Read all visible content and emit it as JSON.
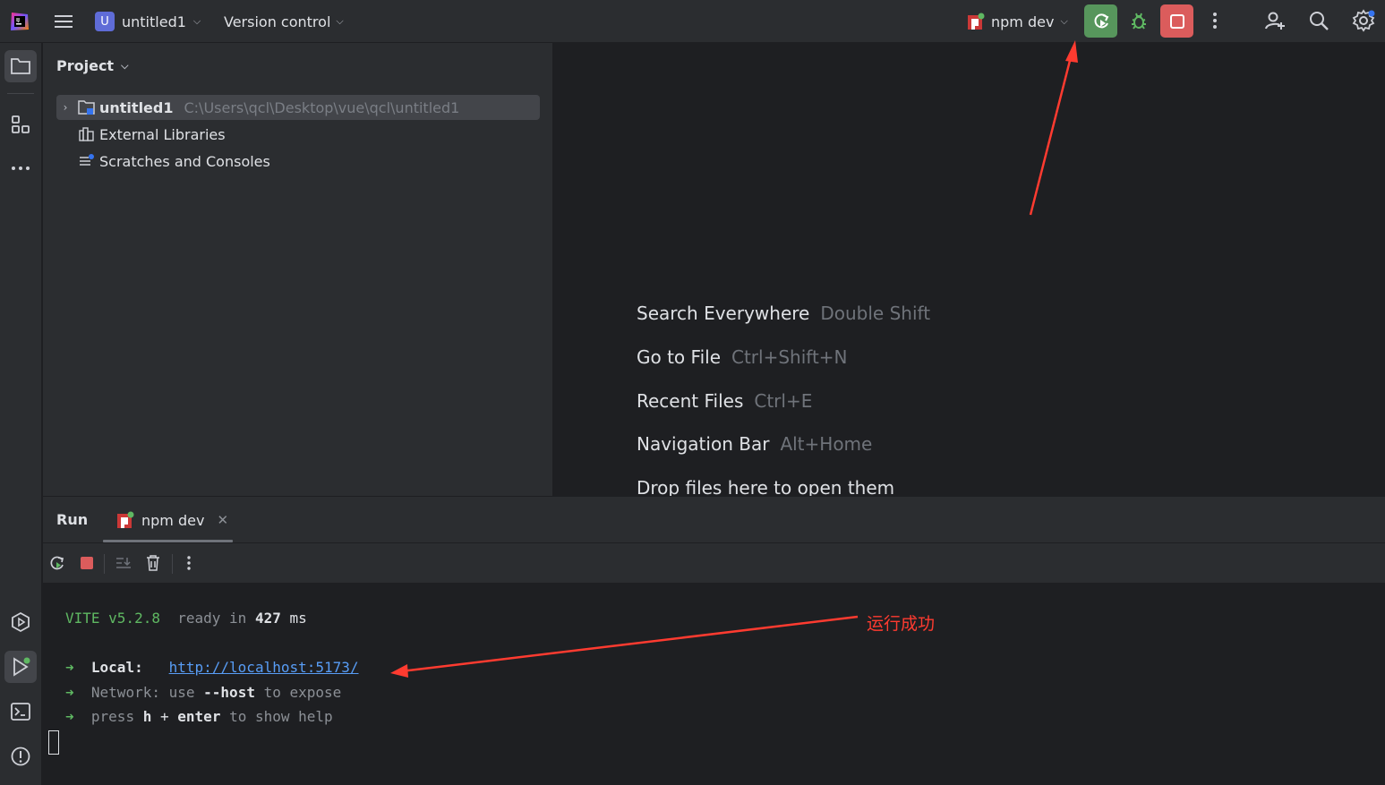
{
  "titlebar": {
    "project_badge": "U",
    "project_name": "untitled1",
    "vcs_label": "Version control",
    "run_config": "npm dev",
    "icons": [
      "app-logo-icon",
      "main-menu-icon",
      "rerun-icon",
      "debug-icon",
      "stop-icon",
      "more-icon",
      "add-user-icon",
      "search-icon",
      "settings-icon"
    ]
  },
  "project_panel": {
    "title": "Project",
    "tree": [
      {
        "label": "untitled1",
        "path": "C:\\Users\\qcl\\Desktop\\vue\\qcl\\untitled1"
      },
      {
        "label": "External Libraries"
      },
      {
        "label": "Scratches and Consoles"
      }
    ]
  },
  "editor": {
    "hints": [
      {
        "label": "Search Everywhere",
        "shortcut": "Double Shift"
      },
      {
        "label": "Go to File",
        "shortcut": "Ctrl+Shift+N"
      },
      {
        "label": "Recent Files",
        "shortcut": "Ctrl+E"
      },
      {
        "label": "Navigation Bar",
        "shortcut": "Alt+Home"
      },
      {
        "label": "Drop files here to open them",
        "shortcut": ""
      }
    ]
  },
  "run_panel": {
    "title": "Run",
    "tab_label": "npm dev",
    "console": {
      "vite": "VITE v5.2.8",
      "ready": "ready in",
      "ms_value": "427",
      "ms_unit": "ms",
      "arrow": "➜",
      "local_label": "Local:",
      "local_url": "http://localhost:5173/",
      "network_label": "Network:",
      "network_use": "use",
      "network_flag": "--host",
      "network_rest": "to expose",
      "press": "press",
      "key_h": "h",
      "plus": "+",
      "key_enter": "enter",
      "help_rest": "to show help"
    }
  },
  "annotation": {
    "text": "运行成功",
    "color": "#ff3b30"
  },
  "colors": {
    "background": "#1e1f22",
    "panel": "#2b2d30",
    "rerun_button": "#57965c",
    "stop_button": "#db5c5c",
    "vite_green": "#5fb862",
    "link": "#589df6"
  }
}
